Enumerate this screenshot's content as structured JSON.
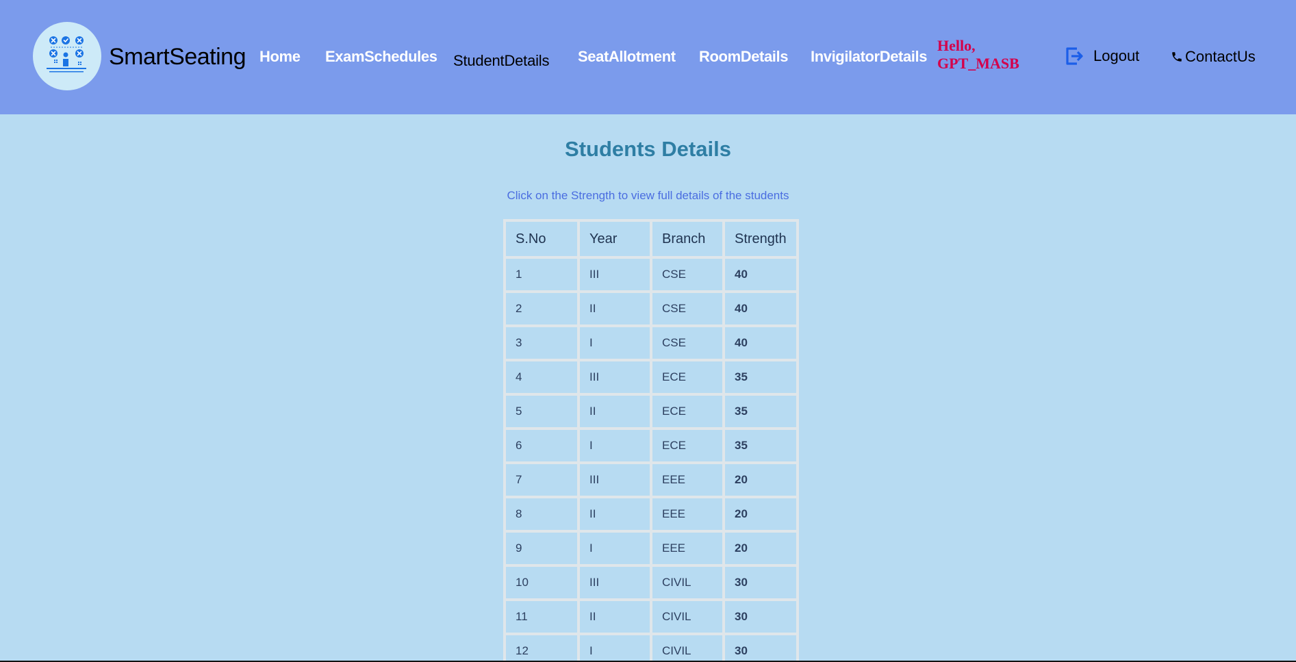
{
  "header": {
    "brand": "SmartSeating",
    "nav": [
      "Home",
      "ExamSchedules",
      "StudentDetails",
      "SeatAllotment",
      "RoomDetails",
      "InvigilatorDetails"
    ],
    "active_nav": "StudentDetails",
    "greeting_line1": "Hello,",
    "greeting_line2": "GPT_MASB",
    "logout_label": "Logout",
    "contact_label": "ContactUs"
  },
  "main": {
    "title": "Students Details",
    "hint": "Click on the Strength to view full details of the students",
    "table": {
      "headers": [
        "S.No",
        "Year",
        "Branch",
        "Strength"
      ],
      "rows": [
        [
          "1",
          "III",
          "CSE",
          "40"
        ],
        [
          "2",
          "II",
          "CSE",
          "40"
        ],
        [
          "3",
          "I",
          "CSE",
          "40"
        ],
        [
          "4",
          "III",
          "ECE",
          "35"
        ],
        [
          "5",
          "II",
          "ECE",
          "35"
        ],
        [
          "6",
          "I",
          "ECE",
          "35"
        ],
        [
          "7",
          "III",
          "EEE",
          "20"
        ],
        [
          "8",
          "II",
          "EEE",
          "20"
        ],
        [
          "9",
          "I",
          "EEE",
          "20"
        ],
        [
          "10",
          "III",
          "CIVIL",
          "30"
        ],
        [
          "11",
          "II",
          "CIVIL",
          "30"
        ],
        [
          "12",
          "I",
          "CIVIL",
          "30"
        ]
      ]
    }
  },
  "colors": {
    "header_bg": "#7b9bec",
    "page_bg": "#b7dbf2",
    "title": "#2e7ea4",
    "hint": "#4a6de0",
    "greeting": "#d4004a",
    "strength_link": "#0a14c6"
  },
  "icons": {
    "logo": "seating-arrangement-icon",
    "logout": "logout-icon",
    "contact": "phone-icon"
  }
}
